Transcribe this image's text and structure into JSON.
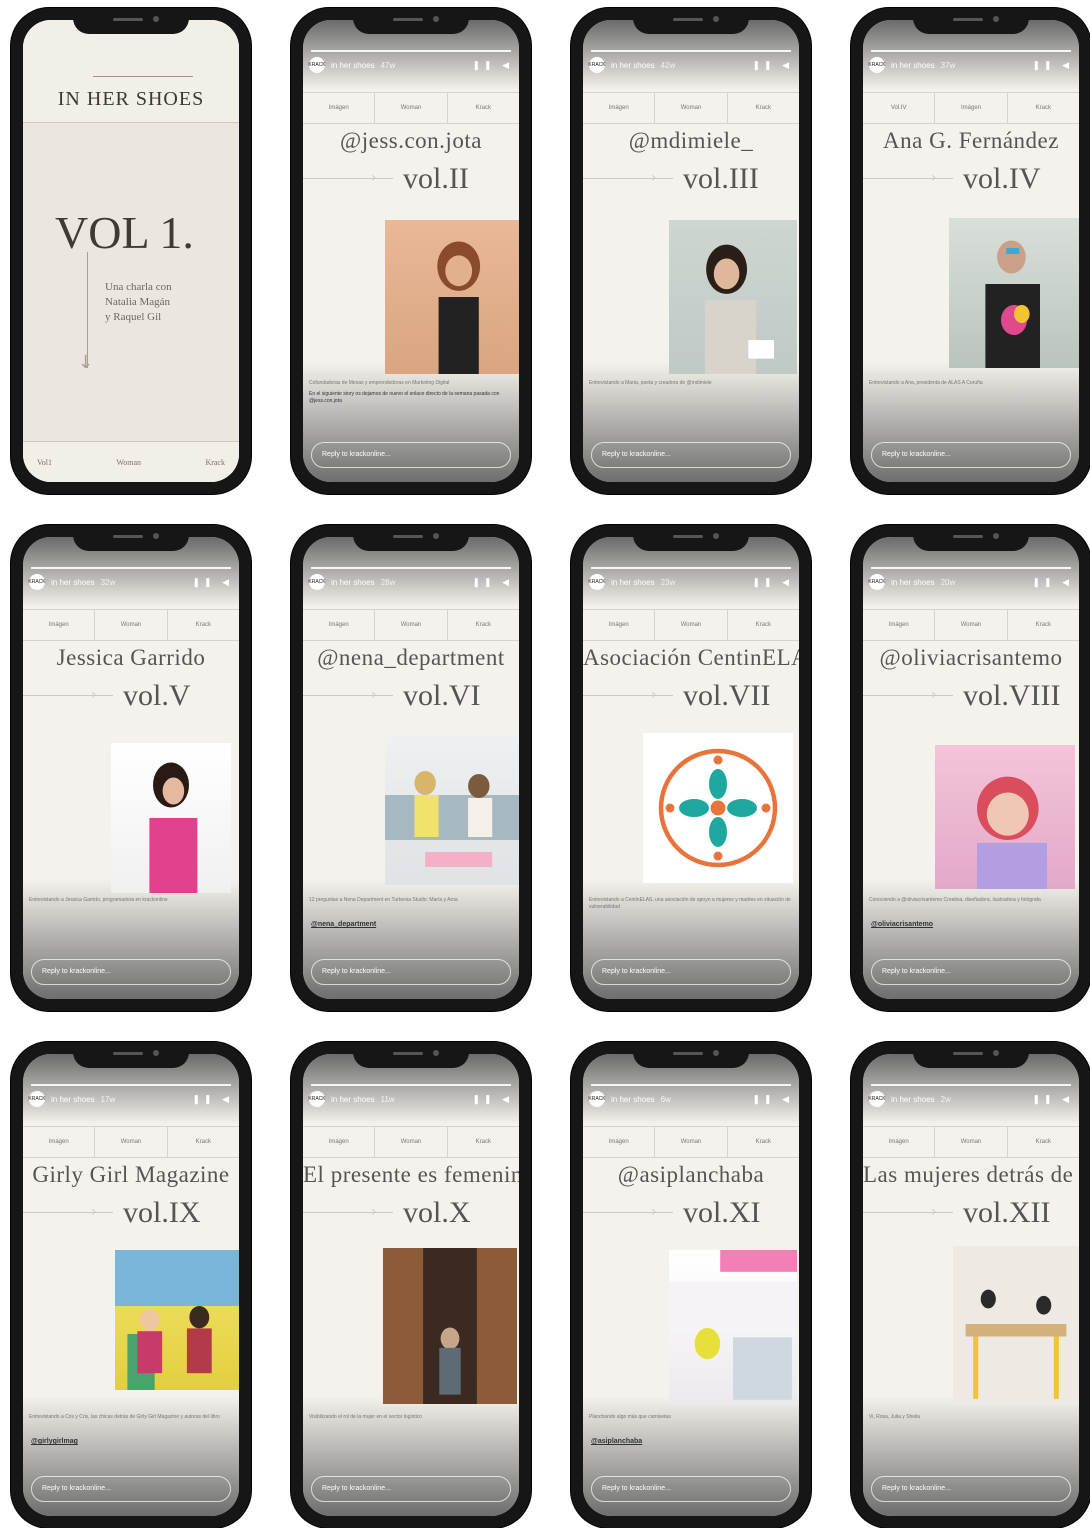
{
  "account": {
    "name": "in her shoes",
    "reply_placeholder": "Reply to krackonline..."
  },
  "cover": {
    "title": "IN HER SHOES",
    "vol": "VOL 1.",
    "sub_lines": [
      "Una charla con",
      "Natalia Magán",
      "y Raquel Gil"
    ],
    "footer": [
      "Vol1",
      "Woman",
      "Krack"
    ]
  },
  "stories": [
    {
      "handle": "@jess.con.jota",
      "vol": "vol.II",
      "time": "47w",
      "nav": [
        "Imágen",
        "Woman",
        "Krack"
      ],
      "caption": "Cofundadoras de Mexas y emprendedoras en Marketing Digital",
      "note": "En el siguiente story os dejamos de nuevo el enlace directo de la semana pasada con @jess.con.jota",
      "tag": ""
    },
    {
      "handle": "@mdimiele_",
      "vol": "vol.III",
      "time": "42w",
      "nav": [
        "Imágen",
        "Woman",
        "Krack"
      ],
      "caption": "Entrevistando a Marta, poeta y creadora de @mdimiele",
      "note": "",
      "tag": ""
    },
    {
      "handle": "Ana G. Fernández",
      "vol": "vol.IV",
      "time": "37w",
      "nav": [
        "Vol.IV",
        "Imágen",
        "Krack"
      ],
      "caption": "Entrevistando a Ana, presidenta de ALAS A Coruña",
      "note": "",
      "tag": ""
    },
    {
      "handle": "Jessica Garrido",
      "vol": "vol.V",
      "time": "32w",
      "nav": [
        "Imágen",
        "Woman",
        "Krack"
      ],
      "caption": "Entrevistando a Jessica Garrido, programadora en krackonline",
      "note": "",
      "tag": ""
    },
    {
      "handle": "@nena_department",
      "vol": "vol.VI",
      "time": "28w",
      "nav": [
        "Imágen",
        "Woman",
        "Krack"
      ],
      "caption": "12 preguntas a Nena Department en Turbenia Studio: María y Aroa",
      "note": "",
      "tag": "@nena_department"
    },
    {
      "handle": "Asociación CentinELAS",
      "vol": "vol.VII",
      "time": "23w",
      "nav": [
        "Imágen",
        "Woman",
        "Krack"
      ],
      "caption": "Entrevistando a CentinELAS, una asociación de apoyo a mujeres y madres en situación de vulnerabilidad",
      "note": "",
      "tag": ""
    },
    {
      "handle": "@oliviacrisantemo",
      "vol": "vol.VIII",
      "time": "20w",
      "nav": [
        "Imágen",
        "Woman",
        "Krack"
      ],
      "caption": "Conociendo a @oliviacrisantemo Creativa, diseñadora, ilustradora y fotógrafa",
      "note": "",
      "tag": "@oliviacrisantemo"
    },
    {
      "handle": "Girly Girl Magazine",
      "vol": "vol.IX",
      "time": "17w",
      "nav": [
        "Imágen",
        "Woman",
        "Krack"
      ],
      "caption": "Entrevistando a Cris y Cris, las chicas detrás de Girly Girl Magazine y autoras del libro",
      "note": "",
      "tag": "@girlygirlmag"
    },
    {
      "handle": "El presente es femenino",
      "vol": "vol.X",
      "time": "11w",
      "nav": [
        "Imágen",
        "Woman",
        "Krack"
      ],
      "caption": "Visibilizando el rol de la mujer en el sector logístico",
      "note": "",
      "tag": ""
    },
    {
      "handle": "@asiplanchaba",
      "vol": "vol.XI",
      "time": "6w",
      "nav": [
        "Imágen",
        "Woman",
        "Krack"
      ],
      "caption": "Planchando algo más que camisetas",
      "note": "",
      "tag": "@asiplanchaba"
    },
    {
      "handle": "Las mujeres detrás de IHS",
      "vol": "vol.XII",
      "time": "2w",
      "nav": [
        "Imágen",
        "Woman",
        "Krack"
      ],
      "caption": "Vi, Rosa, Julia y Sheila",
      "note": "",
      "tag": ""
    }
  ]
}
